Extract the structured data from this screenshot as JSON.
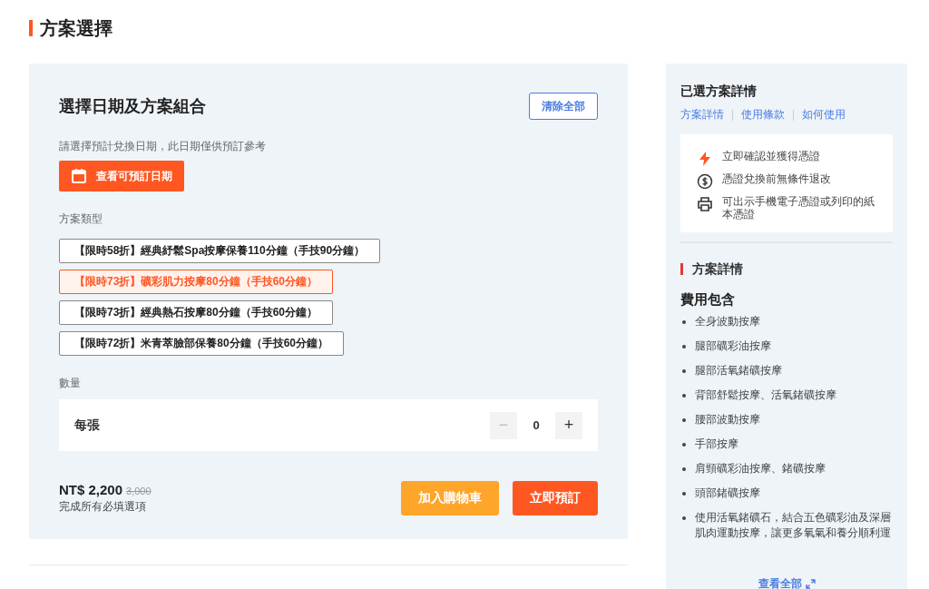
{
  "page_title": "方案選擇",
  "booking": {
    "title": "選擇日期及方案組合",
    "clear_button": "清除全部",
    "date_hint": "請選擇預計兌換日期，此日期僅供預訂參考",
    "date_button": "查看可預訂日期",
    "plan_label": "方案類型",
    "plans": [
      {
        "label": "【限時58折】經典紓鬆Spa按摩保養110分鐘（手技90分鐘）",
        "selected": false
      },
      {
        "label": "【限時73折】礦彩肌力按摩80分鐘（手技60分鐘）",
        "selected": true
      },
      {
        "label": "【限時73折】經典熱石按摩80分鐘（手技60分鐘）",
        "selected": false
      },
      {
        "label": "【限時72折】米青萃臉部保養80分鐘（手技60分鐘）",
        "selected": false
      }
    ],
    "quantity_label": "數量",
    "quantity": {
      "unit": "每張",
      "value": "0",
      "minus": "−",
      "plus": "+",
      "minus_disabled": true
    },
    "price": "NT$ 2,200",
    "original_price": "3,000",
    "price_note": "完成所有必填選項",
    "cart_button": "加入購物車",
    "book_button": "立即預訂"
  },
  "details": {
    "title": "已選方案詳情",
    "links": [
      "方案詳情",
      "使用條款",
      "如何使用"
    ],
    "features": [
      {
        "kind": "bolt",
        "text": "立即確認並獲得憑證"
      },
      {
        "kind": "dollar",
        "text": "憑證兌換前無條件退改"
      },
      {
        "kind": "printer",
        "text": "可出示手機電子憑證或列印的紙本憑證"
      }
    ],
    "section_title": "方案詳情",
    "includes_title": "費用包含",
    "includes": [
      "全身波動按摩",
      "腿部礦彩油按摩",
      "腿部活氧鍺礦按摩",
      "背部舒鬆按摩、活氧鍺礦按摩",
      "腰部波動按摩",
      "手部按摩",
      "肩頸礦彩油按摩、鍺礦按摩",
      "頭部鍺礦按摩",
      "使用活氧鍺礦石，結合五色礦彩油及深層肌肉運動按摩，讓更多氧氣和養分順利運"
    ],
    "see_all": "查看全部"
  }
}
